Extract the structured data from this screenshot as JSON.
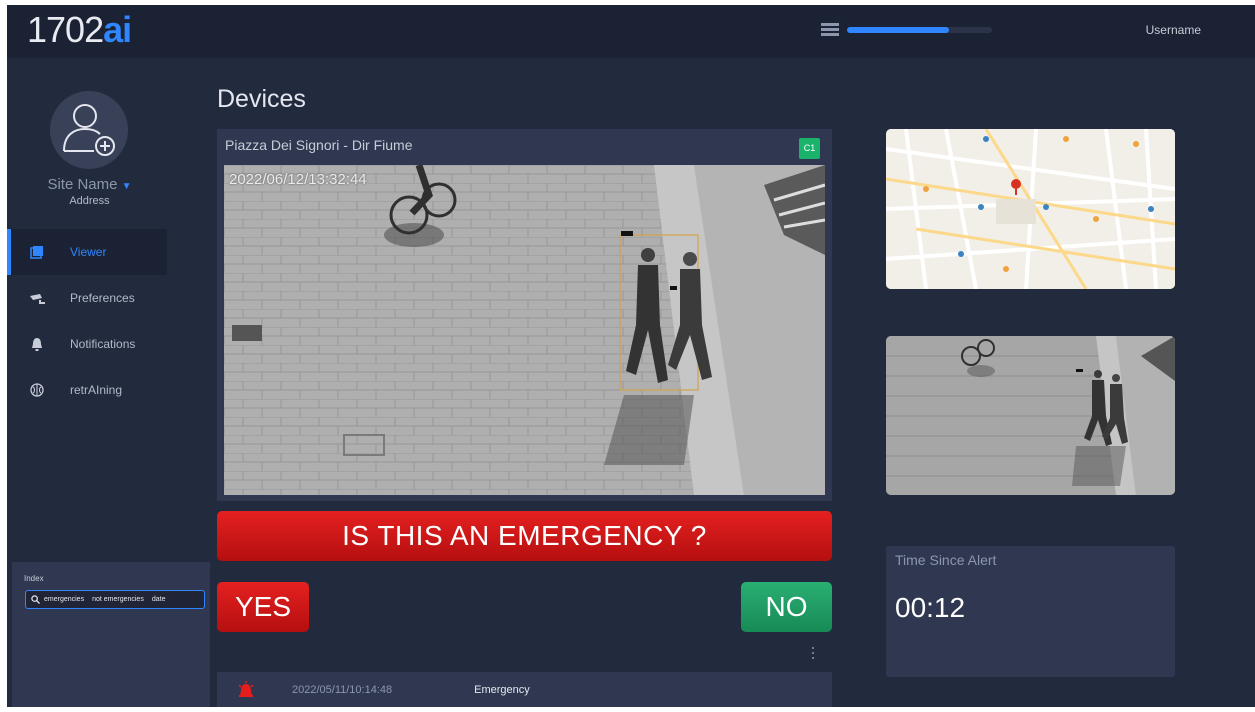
{
  "app": {
    "logo_text": "1702",
    "logo_accent": "ai",
    "accent_color": "#2f86ff"
  },
  "header": {
    "username": "Username",
    "menu_icon": "list-icon",
    "progress": 0.7
  },
  "sidebar": {
    "site_name": "Site Name",
    "site_address": "Address",
    "items": [
      {
        "label": "Viewer",
        "icon": "gallery-icon",
        "active": true
      },
      {
        "label": "Preferences",
        "icon": "camera-icon",
        "active": false
      },
      {
        "label": "Notifications",
        "icon": "bell-icon",
        "active": false
      },
      {
        "label": "retrAIning",
        "icon": "brain-icon",
        "active": false
      }
    ],
    "index": {
      "title": "Index",
      "tags": [
        "emergencies",
        "not emergencies",
        "date"
      ]
    }
  },
  "main": {
    "page_title": "Devices",
    "camera": {
      "title": "Piazza Dei Signori - Dir Fiume",
      "badge": "C1",
      "timestamp": "2022/06/12/13:32:44"
    },
    "question": "IS THIS AN EMERGENCY ?",
    "yes_label": "YES",
    "no_label": "NO",
    "events": [
      {
        "icon": "alarm-icon",
        "timestamp": "2022/05/11/10:14:48",
        "type": "Emergency"
      }
    ]
  },
  "right": {
    "timer_label": "Time Since Alert",
    "timer_value": "00:12"
  },
  "colors": {
    "danger": "#d91a1a",
    "success": "#1f9d63",
    "panel": "#2f3850",
    "background": "#222a3d"
  }
}
